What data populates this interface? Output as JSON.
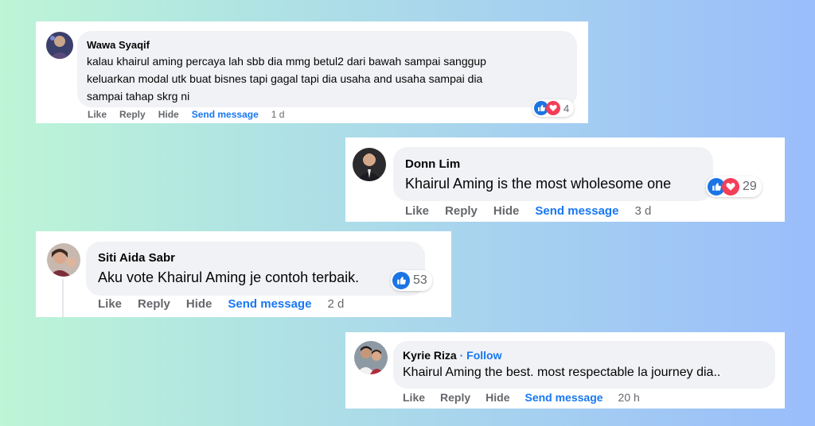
{
  "colors": {
    "link_blue": "#1877f2",
    "muted_gray": "#65676b",
    "bubble_gray": "#f0f2f5",
    "like_blue": "#1b74e4",
    "love_red": "#f33e58"
  },
  "comments": [
    {
      "author": "Wawa Syaqif",
      "lines": [
        "kalau khairul aming percaya lah sbb dia mmg betul2 dari bawah sampai sanggup",
        "keluarkan modal utk buat bisnes tapi gagal tapi dia usaha and usaha sampai dia",
        "sampai tahap skrg ni"
      ],
      "actions": {
        "like": "Like",
        "reply": "Reply",
        "hide": "Hide",
        "send": "Send message",
        "time": "1 d"
      },
      "reactions": {
        "icons": [
          "like-icon",
          "love-icon"
        ],
        "count": "4"
      }
    },
    {
      "author": "Donn Lim",
      "lines": [
        "Khairul Aming is the most wholesome one"
      ],
      "actions": {
        "like": "Like",
        "reply": "Reply",
        "hide": "Hide",
        "send": "Send message",
        "time": "3 d"
      },
      "reactions": {
        "icons": [
          "like-icon",
          "love-icon"
        ],
        "count": "29"
      }
    },
    {
      "author": "Siti Aida Sabr",
      "lines": [
        "Aku vote Khairul Aming je contoh terbaik."
      ],
      "actions": {
        "like": "Like",
        "reply": "Reply",
        "hide": "Hide",
        "send": "Send message",
        "time": "2 d"
      },
      "reactions": {
        "icons": [
          "like-icon"
        ],
        "count": "53"
      }
    },
    {
      "author": "Kyrie Riza",
      "separator": " · ",
      "follow": "Follow",
      "lines": [
        "Khairul Aming the best. most respectable la journey dia.."
      ],
      "actions": {
        "like": "Like",
        "reply": "Reply",
        "hide": "Hide",
        "send": "Send message",
        "time": "20 h"
      }
    }
  ]
}
